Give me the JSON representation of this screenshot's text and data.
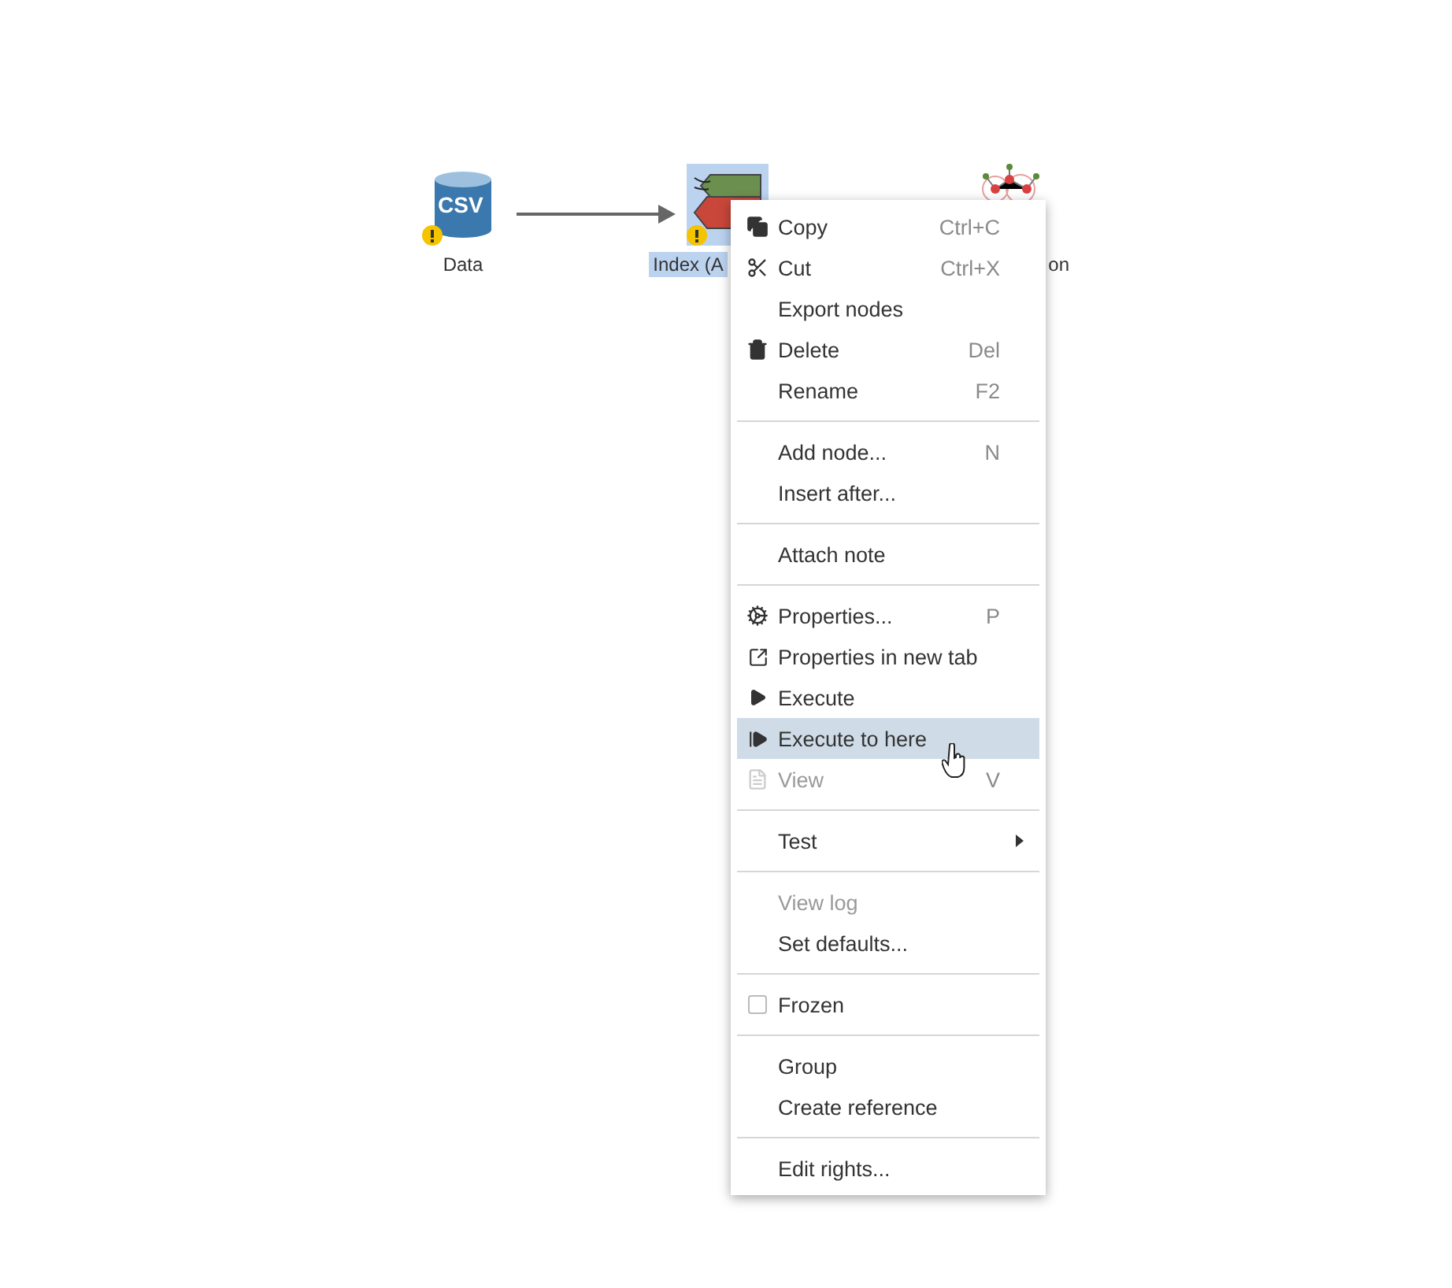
{
  "nodes": [
    {
      "kind": "csv",
      "icon_text": "CSV",
      "label": "Data",
      "warning": true,
      "selected": false
    },
    {
      "kind": "index",
      "label": "Index (A",
      "warning": true,
      "selected": true
    },
    {
      "kind": "network",
      "label": "on",
      "selected": false
    }
  ],
  "context_menu": {
    "sections": [
      [
        {
          "kind": "icon",
          "label": "Copy",
          "shortcut": "Ctrl+C",
          "disabled": false,
          "highlighted": false
        },
        {
          "kind": "icon",
          "label": "Cut",
          "shortcut": "Ctrl+X",
          "disabled": false,
          "highlighted": false
        },
        {
          "kind": "plain",
          "label": "Export nodes",
          "disabled": false,
          "highlighted": false
        },
        {
          "kind": "icon",
          "label": "Delete",
          "shortcut": "Del",
          "disabled": false,
          "highlighted": false
        },
        {
          "kind": "plain",
          "label": "Rename",
          "shortcut": "F2",
          "disabled": false,
          "highlighted": false
        }
      ],
      [
        {
          "kind": "plain",
          "label": "Add node...",
          "shortcut": "N",
          "disabled": false,
          "highlighted": false
        },
        {
          "kind": "plain",
          "label": "Insert after...",
          "disabled": false,
          "highlighted": false
        }
      ],
      [
        {
          "kind": "plain",
          "label": "Attach note",
          "disabled": false,
          "highlighted": false
        }
      ],
      [
        {
          "kind": "icon",
          "label": "Properties...",
          "shortcut": "P",
          "disabled": false,
          "highlighted": false
        },
        {
          "kind": "icon",
          "label": "Properties in new tab",
          "disabled": false,
          "highlighted": false
        },
        {
          "kind": "icon",
          "label": "Execute",
          "disabled": false,
          "highlighted": false
        },
        {
          "kind": "icon",
          "label": "Execute to here",
          "disabled": false,
          "highlighted": true
        },
        {
          "kind": "icon",
          "label": "View",
          "shortcut": "V",
          "disabled": true,
          "highlighted": false
        }
      ],
      [
        {
          "kind": "submenu",
          "label": "Test",
          "disabled": false,
          "highlighted": false
        }
      ],
      [
        {
          "kind": "plain",
          "label": "View log",
          "disabled": true,
          "highlighted": false
        },
        {
          "kind": "plain",
          "label": "Set defaults...",
          "disabled": false,
          "highlighted": false
        }
      ],
      [
        {
          "kind": "checkbox",
          "label": "Frozen",
          "checked": false,
          "disabled": false,
          "highlighted": false
        }
      ],
      [
        {
          "kind": "plain",
          "label": "Group",
          "disabled": false,
          "highlighted": false
        },
        {
          "kind": "plain",
          "label": "Create reference",
          "disabled": false,
          "highlighted": false
        }
      ],
      [
        {
          "kind": "plain",
          "label": "Edit rights...",
          "disabled": false,
          "highlighted": false
        }
      ]
    ]
  }
}
